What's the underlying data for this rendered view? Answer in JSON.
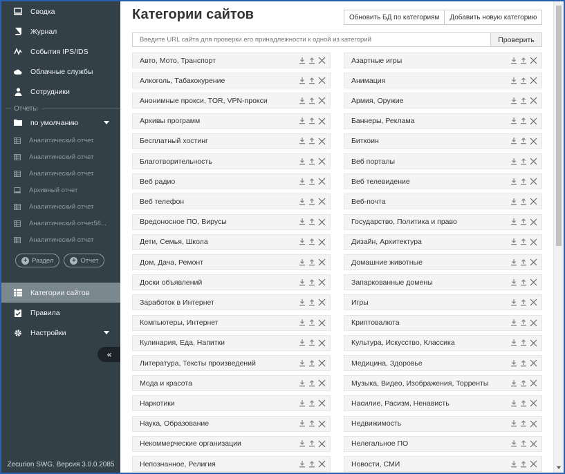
{
  "sidebar": {
    "nav_top": [
      {
        "label": "Сводка",
        "icon": "monitor-icon"
      },
      {
        "label": "Журнал",
        "icon": "book-icon"
      },
      {
        "label": "События IPS/IDS",
        "icon": "pulse-icon"
      },
      {
        "label": "Облачные службы",
        "icon": "cloud-icon"
      },
      {
        "label": "Сотрудники",
        "icon": "user-icon"
      }
    ],
    "reports_section": "Отчеты",
    "folder": "по умолчанию",
    "reports": [
      {
        "label": "Аналитический отчет",
        "icon": "table-icon"
      },
      {
        "label": "Аналитический отчет",
        "icon": "table-icon"
      },
      {
        "label": "Аналитический отчет",
        "icon": "table-icon"
      },
      {
        "label": "Архивный отчет",
        "icon": "archive-icon"
      },
      {
        "label": "Аналитический отчет",
        "icon": "table-icon"
      },
      {
        "label": "Аналитический отчет56...",
        "icon": "table-icon"
      },
      {
        "label": "Аналитический отчет",
        "icon": "table-icon"
      }
    ],
    "add_section": "Раздел",
    "add_report": "Отчет",
    "nav_bottom": [
      {
        "label": "Категории сайтов",
        "icon": "list-icon",
        "active": true
      },
      {
        "label": "Правила",
        "icon": "clipboard-icon"
      },
      {
        "label": "Настройки",
        "icon": "gear-icon"
      }
    ],
    "collapse_glyph": "«",
    "version": "Zecurion SWG. Версия 3.0.0.2085"
  },
  "main": {
    "title": "Категории сайтов",
    "update_db_label": "Обновить БД по категориям",
    "add_category_label": "Добавить новую категорию",
    "search_placeholder": "Введите URL сайта для проверки его принадлежности к одной из категорий",
    "check_label": "Проверить",
    "categories_left": [
      "Авто, Мото, Транспорт",
      "Алкоголь, Табакокурение",
      "Анонимные прокси, TOR, VPN-прокси",
      "Архивы программ",
      "Бесплатный хостинг",
      "Благотворительность",
      "Веб радио",
      "Веб телефон",
      "Вредоносное ПО, Вирусы",
      "Дети, Семья, Школа",
      "Дом, Дача, Ремонт",
      "Доски объявлений",
      "Заработок в Интернет",
      "Компьютеры, Интернет",
      "Кулинария, Еда, Напитки",
      "Литература, Тексты произведений",
      "Мода и красота",
      "Наркотики",
      "Наука, Образование",
      "Некоммерческие организации",
      "Непознанное, Религия"
    ],
    "categories_right": [
      "Азартные игры",
      "Анимация",
      "Армия, Оружие",
      "Баннеры, Реклама",
      "Биткоин",
      "Веб порталы",
      "Веб телевидение",
      "Веб-почта",
      "Государство, Политика и право",
      "Дизайн, Архитектура",
      "Домашние животные",
      "Запаркованные домены",
      "Игры",
      "Криптовалюта",
      "Культура, Искусство, Классика",
      "Медицина, Здоровье",
      "Музыка, Видео, Изображения, Торренты",
      "Насилие, Расизм, Ненависть",
      "Недвижимость",
      "Нелегальное ПО",
      "Новости, СМИ"
    ]
  },
  "colors": {
    "sidebar_bg": "#334048",
    "sidebar_active": "#7c8890",
    "cell_bg": "#f4f4f4",
    "frame_border": "#2a5fae"
  }
}
